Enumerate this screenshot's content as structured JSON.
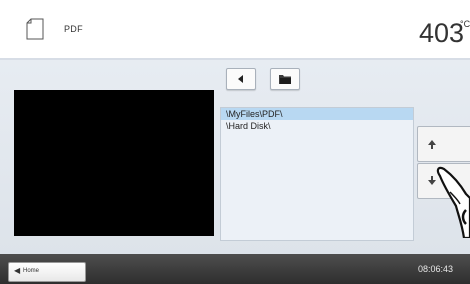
{
  "header": {
    "title": "PDF",
    "temperature": "403",
    "temperature_unit": "°C"
  },
  "file_list": {
    "items": [
      {
        "label": "\\MyFiles\\PDF\\",
        "selected": true
      },
      {
        "label": "\\Hard Disk\\",
        "selected": false
      }
    ]
  },
  "footer": {
    "home_label": "Home",
    "clock": "08:06:43"
  },
  "icons": {
    "document": "document-icon",
    "back": "triangle-left-icon",
    "folder": "folder-icon",
    "scroll_up": "arrow-up-icon",
    "scroll_down": "arrow-down-icon",
    "home": "arrow-left-icon"
  },
  "colors": {
    "panel_background": "#e2e7ee",
    "selection": "#b8d8f2",
    "footer": "#3a3a3a"
  }
}
